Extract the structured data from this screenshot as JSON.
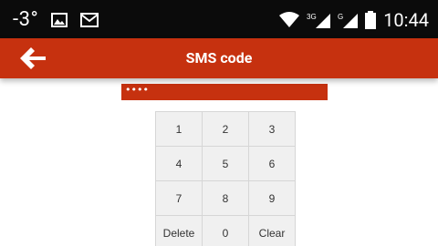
{
  "status_bar": {
    "temperature": "-3°",
    "image_icon": "image-icon",
    "mail_icon": "mail-icon",
    "wifi_icon": "wifi-icon",
    "signal_3g_label": "3G",
    "signal_g_label": "G",
    "battery_icon": "battery-icon",
    "time": "10:44"
  },
  "app_bar": {
    "title": "SMS code",
    "back_icon": "back-arrow-icon",
    "color": "#c6310f"
  },
  "code_field": {
    "value": "••••"
  },
  "keypad": {
    "keys": [
      "1",
      "2",
      "3",
      "4",
      "5",
      "6",
      "7",
      "8",
      "9",
      "Delete",
      "0",
      "Clear"
    ]
  }
}
